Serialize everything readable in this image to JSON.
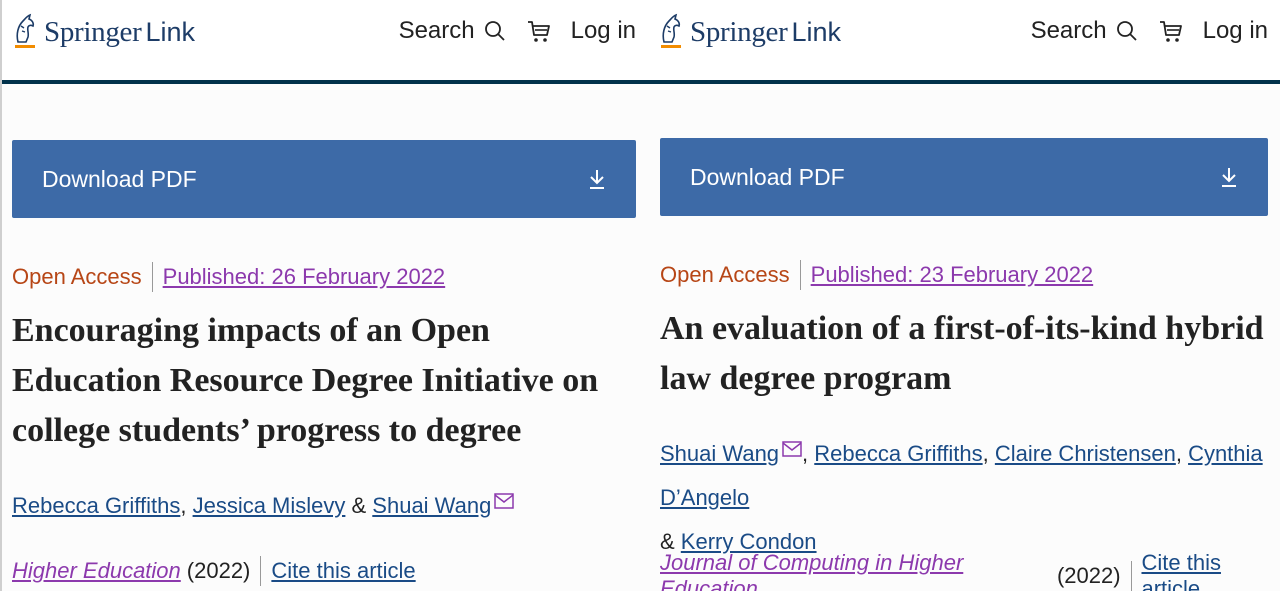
{
  "brand": {
    "name": "Springer",
    "suffix": "Link",
    "color": "#1d3c67"
  },
  "colors": {
    "download_bar": "#3d6aa7",
    "open_access": "#b74616",
    "published_link": "#8c39ad",
    "author_link": "#1a4b86",
    "header_rule": "#01324b"
  },
  "header": {
    "search_label": "Search",
    "login_label": "Log in"
  },
  "articles": [
    {
      "download_label": "Download PDF",
      "open_access": "Open Access",
      "published": "Published: 26 February 2022",
      "title": "Encouraging impacts of an Open Education Resource Degree Initiative on college students’ progress to degree",
      "authors": {
        "a1": "Rebecca Griffiths",
        "sep1": ", ",
        "a2": "Jessica Mislevy",
        "sep2": " & ",
        "a3": "Shuai Wang"
      },
      "journal": "Higher Education",
      "year": "(2022)",
      "cite": "Cite this article"
    },
    {
      "download_label": "Download PDF",
      "open_access": "Open Access",
      "published": "Published: 23 February 2022",
      "title": "An evaluation of a first-of-its-kind hybrid law degree program",
      "authors": {
        "a1": "Shuai Wang",
        "sep1": ", ",
        "a2": "Rebecca Griffiths",
        "sep2": ", ",
        "a3": "Claire Christensen",
        "sep3": ", ",
        "a4": "Cynthia D’Angelo",
        "sep4": "& ",
        "a5": "Kerry Condon"
      },
      "journal": "Journal of Computing in Higher Education",
      "year": "(2022)",
      "cite": "Cite this article"
    }
  ]
}
